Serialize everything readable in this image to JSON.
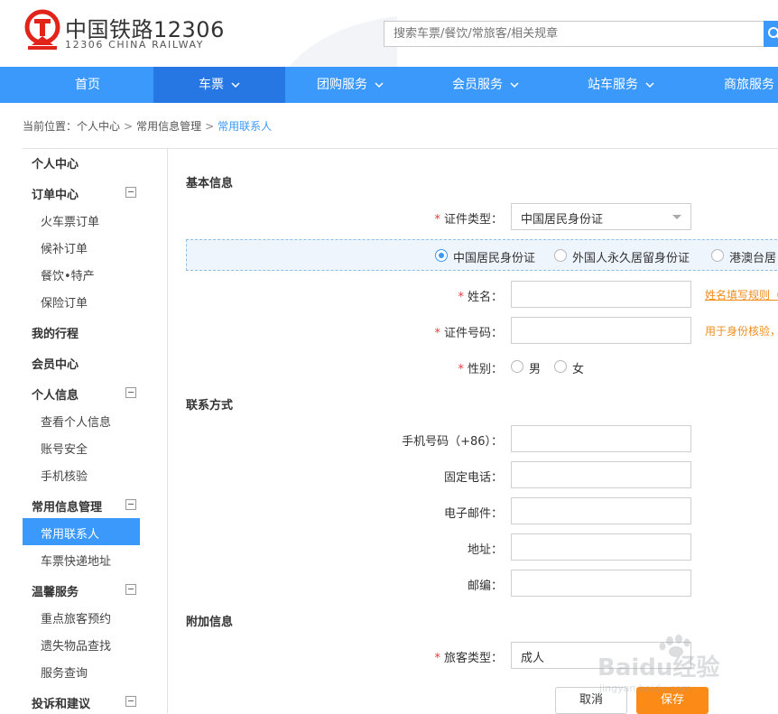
{
  "header": {
    "brand_cn": "中国铁路12306",
    "brand_en": "12306 CHINA RAILWAY",
    "search_placeholder": "搜索车票/餐饮/常旅客/相关规章",
    "brand_color": "#e2231a",
    "accent_color": "#3b99fc"
  },
  "nav": {
    "items": [
      {
        "label": "首页"
      },
      {
        "label": "车票"
      },
      {
        "label": "团购服务"
      },
      {
        "label": "会员服务"
      },
      {
        "label": "站车服务"
      },
      {
        "label": "商旅服务"
      }
    ]
  },
  "breadcrumb": {
    "prefix": "当前位置：",
    "items": [
      "个人中心",
      "常用信息管理",
      "常用联系人"
    ],
    "separator": ">"
  },
  "sidebar": {
    "personal_center": "个人中心",
    "order_center": "订单中心",
    "order_items": [
      "火车票订单",
      "候补订单",
      "餐饮•特产",
      "保险订单"
    ],
    "my_trips": "我的行程",
    "member_center": "会员中心",
    "personal_info": "个人信息",
    "info_items": [
      "查看个人信息",
      "账号安全",
      "手机核验"
    ],
    "common_info": "常用信息管理",
    "common_items": [
      "常用联系人",
      "车票快递地址"
    ],
    "warm_service": "温馨服务",
    "warm_items": [
      "重点旅客预约",
      "遗失物品查找",
      "服务查询"
    ],
    "complaints": "投诉和建议"
  },
  "form": {
    "basic_title": "基本信息",
    "id_type_label": "证件类型：",
    "id_type_value": "中国居民身份证",
    "id_options": [
      "中国居民身份证",
      "外国人永久居留身份证",
      "港澳台居"
    ],
    "name_label": "姓名：",
    "name_hint": "姓名填写规则（",
    "id_number_label": "证件号码：",
    "id_number_hint": "用于身份核验，",
    "gender_label": "性别：",
    "gender_options": [
      "男",
      "女"
    ],
    "contact_title": "联系方式",
    "phone_label": "手机号码（+86）：",
    "landline_label": "固定电话：",
    "email_label": "电子邮件：",
    "address_label": "地址：",
    "postcode_label": "邮编：",
    "extra_title": "附加信息",
    "passenger_type_label": "旅客类型：",
    "passenger_type_value": "成人",
    "required_mark": "*",
    "cancel_label": "取消",
    "save_label": "保存",
    "save_color": "#fb8a16"
  },
  "watermark": {
    "text_main": "Baidu经验",
    "text_sub": "jingyan.baidu.com"
  }
}
